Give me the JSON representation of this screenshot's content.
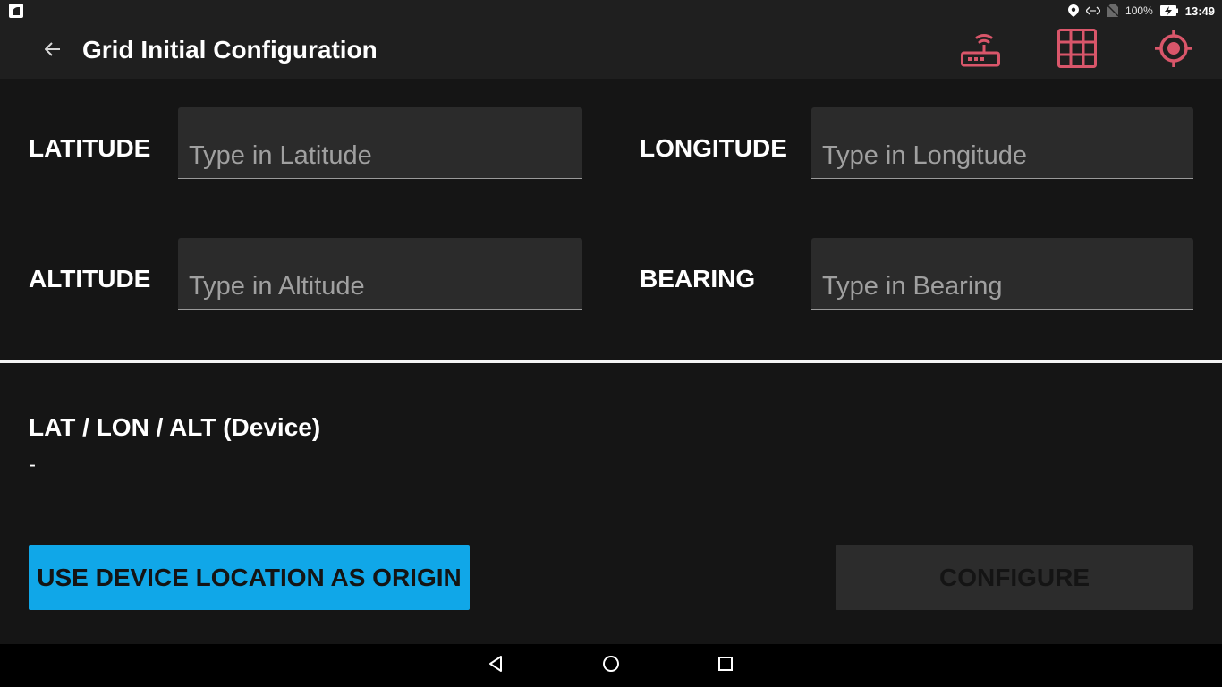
{
  "status_bar": {
    "battery": "100%",
    "time": "13:49",
    "icons": [
      "app-icon",
      "location-icon",
      "data-sync-icon",
      "no-sim-icon",
      "battery-charging-icon"
    ]
  },
  "toolbar": {
    "title": "Grid Initial Configuration",
    "back_icon": "arrow-left-icon",
    "actions": [
      "router-icon",
      "grid-icon",
      "gps-target-icon"
    ],
    "accent_color": "#d9566a"
  },
  "form": {
    "latitude": {
      "label": "LATITUDE",
      "placeholder": "Type in Latitude",
      "value": ""
    },
    "longitude": {
      "label": "LONGITUDE",
      "placeholder": "Type in Longitude",
      "value": ""
    },
    "altitude": {
      "label": "ALTITUDE",
      "placeholder": "Type in Altitude",
      "value": ""
    },
    "bearing": {
      "label": "BEARING",
      "placeholder": "Type in Bearing",
      "value": ""
    }
  },
  "device": {
    "label": "LAT / LON / ALT (Device)",
    "value": "-"
  },
  "buttons": {
    "use_device": "USE DEVICE LOCATION AS ORIGIN",
    "configure": "CONFIGURE",
    "primary_color": "#10a7e8"
  },
  "nav_bar": {
    "icons": [
      "back-triangle-icon",
      "home-circle-icon",
      "recents-square-icon"
    ]
  }
}
